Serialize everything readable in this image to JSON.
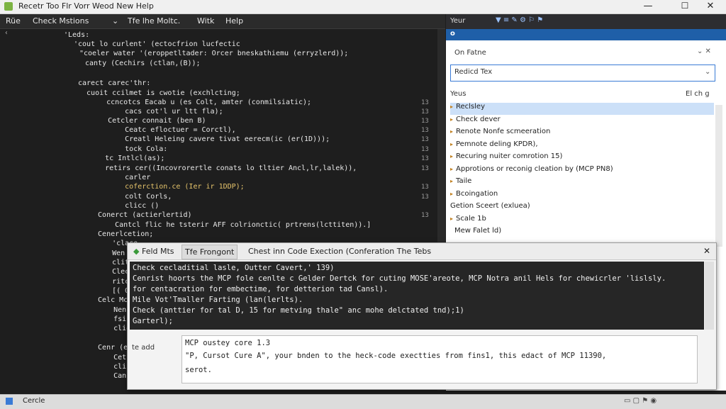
{
  "window": {
    "title": "Recetr Too Flr Vorr Weod New Help",
    "minimize": "—",
    "maximize": "☐",
    "close": "✕"
  },
  "toolbar": {
    "items": [
      "Rüe",
      "Check Mstions",
      "⌄",
      "Tfe lhe Moltc.",
      "Witk",
      "Help"
    ]
  },
  "editor": {
    "lines": [
      "'Leds:",
      "'cout lo curlent' (ectocfrion lucfectic",
      "\"coeler water '(eroppetltader: Orcer bneskathiemu (erryzlerd));",
      "canty (Cechirs (ctlan,(B));",
      "",
      "carect carec'thr:",
      "  cuoit ccilmet is cwotie (exchlcting;",
      "    ccncotcs Eacab u (es Colt, amter (conmilsiatic);",
      "      cacs cot'l ur ltt fla);",
      "    Cetcler connait (ben B)",
      "      Ceatc efloctuer = Corctl),",
      "      Creatl Heleing cavere tivat eerecm(ic (er(1D)));",
      "      tock Cola:",
      "    tc Intlcl(as);",
      "    retirs cer((Incovrorertle conats lo tltier Ancl,lr,lalek)),",
      "      carler",
      "      coferction.ce (Ier ir 1DDP);",
      "      colt Corls,",
      "      clicc ()",
      "  Conerct (actierlertid)",
      "    Cantcl flic he tsterir AFF colrionctic( prtrens(lcttiten)).]",
      "  Cenerlcetion;",
      "    'clace",
      "    Wen (",
      "    clitc",
      "    Clec (",
      "    ritce",
      "    [( Occ",
      "  Celc Mct",
      "    Nencle",
      "    fsi(",
      "    cliol",
      "",
      "  Cenr (ect",
      "    Cetrac",
      "    clic (",
      "    Canite"
    ],
    "line_numbers": [
      "13",
      "13",
      "13",
      "13",
      "13",
      "13",
      "13",
      "13",
      "13",
      "13",
      "13"
    ]
  },
  "sidebar": {
    "top_label": "Yeur",
    "header_char": "o",
    "section_title": "On Fatne",
    "dropdown_value": "Redicd Tex",
    "results_label": "Yeus",
    "results_count": "El ch g",
    "items": [
      {
        "label": "Reclsley",
        "arrow": "▸",
        "selected": true
      },
      {
        "label": "Check dever",
        "arrow": "▸",
        "selected": false
      },
      {
        "label": "Renote Nonfe scmeeration",
        "arrow": "▸",
        "selected": false
      },
      {
        "label": "Pemnote deling KPDR),",
        "arrow": "▸",
        "selected": false
      },
      {
        "label": "Recuring nuiter comrotion 15)",
        "arrow": "▸",
        "selected": false
      },
      {
        "label": "Approtions or reconig cleation by (MCP PN8)",
        "arrow": "▸",
        "selected": false
      },
      {
        "label": "Taile",
        "arrow": "▸",
        "selected": false
      },
      {
        "label": "Bcoingation",
        "arrow": "▸",
        "selected": false
      },
      {
        "label": "Getion Sceert (exluea)",
        "arrow": "",
        "selected": false
      },
      {
        "label": "Scale 1b",
        "arrow": "▸",
        "selected": false
      },
      {
        "label": "Mew Falet ld)",
        "arrow": "",
        "selected": false
      }
    ]
  },
  "dialog": {
    "tabs": [
      "Feld Mts",
      "Tfe Frongont",
      "Chest inn Code Exection (Conferation The Tebs"
    ],
    "output_lines": [
      "Check cecladitial lasle, Outter Cavert,' 139)",
      "Cenrist hoorts the MCP fole cenlte c Gelder Dertck for cuting MOSE'areote, MCP Notra anil Hels for chewicrler 'lislsly.",
      "for centacration for embectime, for detterion tad Cansl).",
      "Mile Vot'Tmaller Farting (lan(lerlts).",
      "Check (anttier for tal D, 15 for metving thale\" anc mohe delctated tnd);1)",
      "Garterl);"
    ],
    "input_label": "te add",
    "input_lines": [
      "MCP oustey core 1.3",
      "\"P, Cursot Cure A\", your bnden to the heck-code exectties from fins1, this edact of MCP 11390,",
      "serot."
    ]
  },
  "statusbar": {
    "left": "Cercle"
  },
  "colors": {
    "accent": "#1f5fa8",
    "editor_bg": "#1e1e1e",
    "selected": "#cce0f8"
  }
}
